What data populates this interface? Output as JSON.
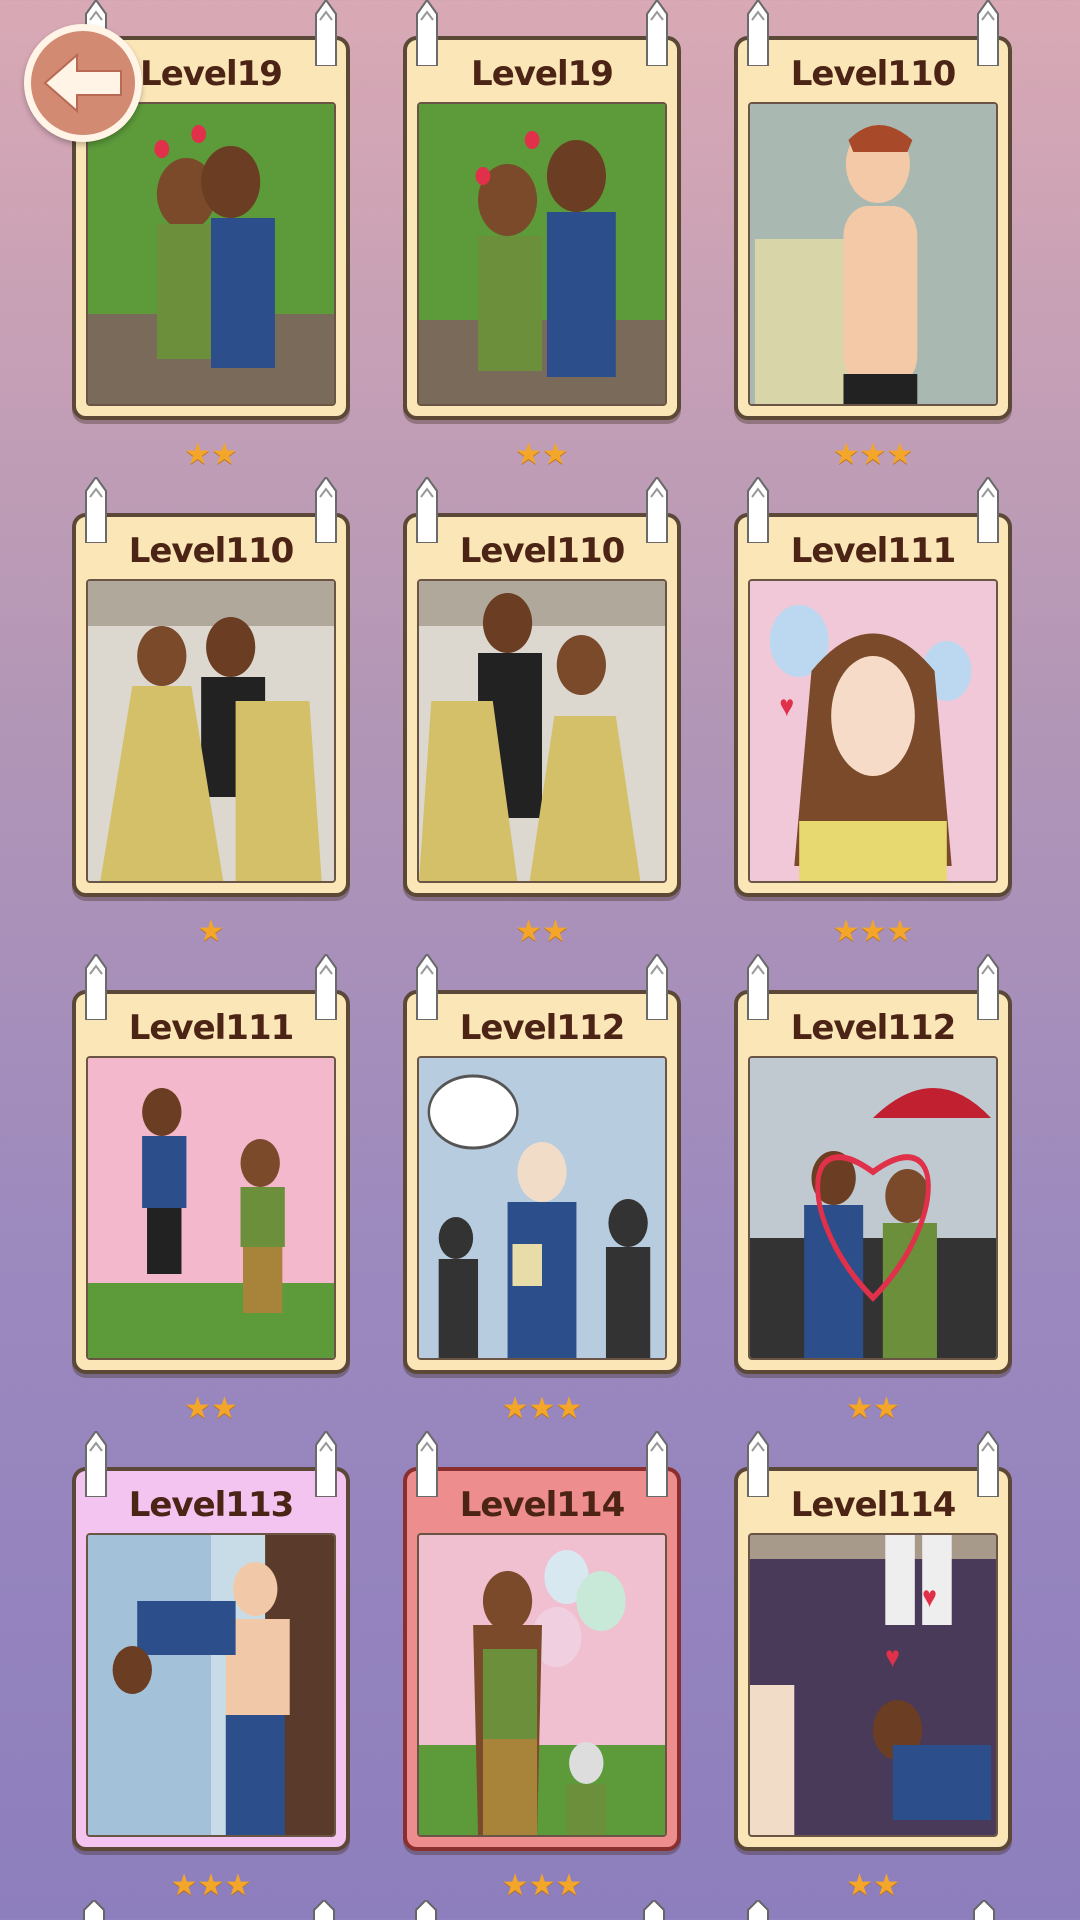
{
  "colors": {
    "star": "#f4a62a",
    "card_default": "#fbe6b8",
    "card_pink": "#f4c4f1",
    "card_red": "#ee8d8d",
    "title_text": "#4c2416"
  },
  "back_button": {
    "icon": "arrow-left-icon"
  },
  "cards": [
    {
      "title": "Level19",
      "stars": "★★",
      "style": "default",
      "scene": "couple-kiss-garden"
    },
    {
      "title": "Level19",
      "stars": "★★",
      "style": "default",
      "scene": "couple-embrace-garden"
    },
    {
      "title": "Level110",
      "stars": "★★★",
      "style": "default",
      "scene": "shirtless-man-blushing"
    },
    {
      "title": "Level110",
      "stars": "★",
      "style": "default",
      "scene": "couple-dancing-gold-dress"
    },
    {
      "title": "Level110",
      "stars": "★★",
      "style": "default",
      "scene": "couple-dancing-mirror"
    },
    {
      "title": "Level111",
      "stars": "★★★",
      "style": "default",
      "scene": "girl-winking"
    },
    {
      "title": "Level111",
      "stars": "★★",
      "style": "default",
      "scene": "couple-jumping-blossoms"
    },
    {
      "title": "Level112",
      "stars": "★★★",
      "style": "default",
      "scene": "bald-man-crowd"
    },
    {
      "title": "Level112",
      "stars": "★★",
      "style": "default",
      "scene": "couple-umbrella-heart"
    },
    {
      "title": "Level113",
      "stars": "★★★",
      "style": "pink",
      "scene": "man-carrying-man"
    },
    {
      "title": "Level114",
      "stars": "★★★",
      "style": "red",
      "scene": "girl-balloons-grandma"
    },
    {
      "title": "Level114",
      "stars": "★★",
      "style": "default",
      "scene": "boy-kneeling-hearts"
    }
  ]
}
